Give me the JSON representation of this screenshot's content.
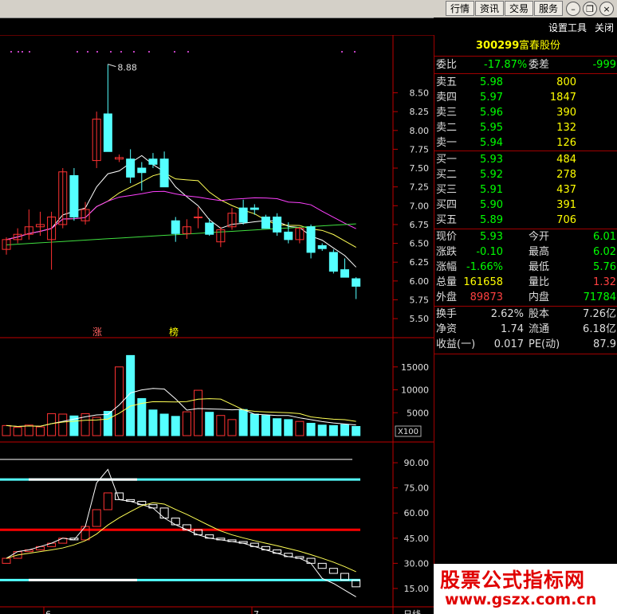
{
  "toolbar": {
    "tabs": [
      "行情",
      "资讯",
      "交易",
      "服务"
    ],
    "settings_label": "设置工具",
    "close_label": "关闭"
  },
  "stock": {
    "code": "300299",
    "name": "富春股份"
  },
  "quote_ratio": {
    "label": "委比",
    "value": "-17.87%",
    "diff_label": "委差",
    "diff_value": "-999"
  },
  "asks": [
    {
      "label": "卖五",
      "price": "5.98",
      "volume": "800"
    },
    {
      "label": "卖四",
      "price": "5.97",
      "volume": "1847"
    },
    {
      "label": "卖三",
      "price": "5.96",
      "volume": "390"
    },
    {
      "label": "卖二",
      "price": "5.95",
      "volume": "132"
    },
    {
      "label": "卖一",
      "price": "5.94",
      "volume": "126"
    }
  ],
  "bids": [
    {
      "label": "买一",
      "price": "5.93",
      "volume": "484"
    },
    {
      "label": "买二",
      "price": "5.92",
      "volume": "278"
    },
    {
      "label": "买三",
      "price": "5.91",
      "volume": "437"
    },
    {
      "label": "买四",
      "price": "5.90",
      "volume": "391"
    },
    {
      "label": "买五",
      "price": "5.89",
      "volume": "706"
    }
  ],
  "stats": [
    {
      "l1": "现价",
      "v1": "5.93",
      "c1": "#00ff00",
      "l2": "今开",
      "v2": "6.01",
      "c2": "#00ff00"
    },
    {
      "l1": "涨跌",
      "v1": "-0.10",
      "c1": "#00ff00",
      "l2": "最高",
      "v2": "6.02",
      "c2": "#00ff00"
    },
    {
      "l1": "涨幅",
      "v1": "-1.66%",
      "c1": "#00ff00",
      "l2": "最低",
      "v2": "5.76",
      "c2": "#00ff00"
    },
    {
      "l1": "总量",
      "v1": "161658",
      "c1": "#ffff00",
      "l2": "量比",
      "v2": "1.32",
      "c2": "#ff4040"
    },
    {
      "l1": "外盘",
      "v1": "89873",
      "c1": "#ff4040",
      "l2": "内盘",
      "v2": "71784",
      "c2": "#00ff00"
    }
  ],
  "fundamentals": [
    {
      "l1": "换手",
      "v1": "2.62%",
      "l2": "股本",
      "v2": "7.26亿"
    },
    {
      "l1": "净资",
      "v1": "1.74",
      "l2": "流通",
      "v2": "6.18亿"
    },
    {
      "l1": "收益(一)",
      "v1": "0.017",
      "l2": "PE(动)",
      "v2": "87.9"
    }
  ],
  "price_axis": [
    "8.50",
    "8.25",
    "8.00",
    "7.75",
    "7.50",
    "7.25",
    "7.00",
    "6.75",
    "6.50",
    "6.25",
    "6.00",
    "5.75",
    "5.50"
  ],
  "volume_axis": [
    "15000",
    "10000",
    "5000"
  ],
  "volume_unit": "X100",
  "indicator_axis": [
    "90.00",
    "75.00",
    "60.00",
    "45.00",
    "30.00",
    "15.00"
  ],
  "high_annotation": "8.88",
  "chart_markers": [
    "涨",
    "榜"
  ],
  "time_labels": [
    "6",
    "7"
  ],
  "period_label": "日线",
  "watermark": {
    "line1": "股票公式指标网",
    "line2": "www.gszx.com.cn"
  },
  "colors": {
    "up": "#ff3232",
    "down": "#54ffff",
    "panel_border": "#a00000",
    "text_up": "#ff4040",
    "text_down": "#00ff00"
  },
  "chart_data": {
    "type": "candlestick",
    "candles": [
      {
        "o": 6.42,
        "h": 6.58,
        "l": 6.35,
        "c": 6.55
      },
      {
        "o": 6.55,
        "h": 6.7,
        "l": 6.5,
        "c": 6.62
      },
      {
        "o": 6.62,
        "h": 6.95,
        "l": 6.55,
        "c": 6.72
      },
      {
        "o": 6.72,
        "h": 6.92,
        "l": 6.6,
        "c": 6.75
      },
      {
        "o": 6.55,
        "h": 6.92,
        "l": 6.15,
        "c": 6.85
      },
      {
        "o": 6.75,
        "h": 7.5,
        "l": 6.7,
        "c": 7.45
      },
      {
        "o": 7.4,
        "h": 7.5,
        "l": 6.8,
        "c": 6.85
      },
      {
        "o": 6.8,
        "h": 7.05,
        "l": 6.75,
        "c": 6.95
      },
      {
        "o": 7.6,
        "h": 8.25,
        "l": 7.5,
        "c": 8.15
      },
      {
        "o": 8.22,
        "h": 8.88,
        "l": 7.8,
        "c": 7.72
      },
      {
        "o": 7.62,
        "h": 7.68,
        "l": 7.58,
        "c": 7.64
      },
      {
        "o": 7.62,
        "h": 7.75,
        "l": 7.3,
        "c": 7.38
      },
      {
        "o": 7.5,
        "h": 7.58,
        "l": 7.2,
        "c": 7.44
      },
      {
        "o": 7.62,
        "h": 7.7,
        "l": 7.5,
        "c": 7.55
      },
      {
        "o": 7.62,
        "h": 7.72,
        "l": 7.25,
        "c": 7.25
      },
      {
        "o": 6.8,
        "h": 6.85,
        "l": 6.52,
        "c": 6.63
      },
      {
        "o": 6.63,
        "h": 6.82,
        "l": 6.56,
        "c": 6.72
      },
      {
        "o": 6.85,
        "h": 6.98,
        "l": 6.7,
        "c": 6.85
      },
      {
        "o": 6.77,
        "h": 6.83,
        "l": 6.6,
        "c": 6.62
      },
      {
        "o": 6.52,
        "h": 6.72,
        "l": 6.45,
        "c": 6.68
      },
      {
        "o": 6.72,
        "h": 6.97,
        "l": 6.68,
        "c": 6.9
      },
      {
        "o": 6.97,
        "h": 7.08,
        "l": 6.75,
        "c": 6.78
      },
      {
        "o": 6.97,
        "h": 7.02,
        "l": 6.88,
        "c": 6.95
      },
      {
        "o": 6.85,
        "h": 6.88,
        "l": 6.7,
        "c": 6.7
      },
      {
        "o": 6.85,
        "h": 6.9,
        "l": 6.6,
        "c": 6.65
      },
      {
        "o": 6.65,
        "h": 6.78,
        "l": 6.5,
        "c": 6.55
      },
      {
        "o": 6.55,
        "h": 6.72,
        "l": 6.5,
        "c": 6.7
      },
      {
        "o": 6.72,
        "h": 6.75,
        "l": 6.3,
        "c": 6.38
      },
      {
        "o": 6.47,
        "h": 6.5,
        "l": 6.4,
        "c": 6.43
      },
      {
        "o": 6.38,
        "h": 6.42,
        "l": 6.1,
        "c": 6.13
      },
      {
        "o": 6.15,
        "h": 6.3,
        "l": 6.05,
        "c": 6.05
      },
      {
        "o": 6.03,
        "h": 6.05,
        "l": 5.76,
        "c": 5.93
      }
    ],
    "volumes": [
      2200,
      1800,
      2300,
      1900,
      4800,
      4700,
      4300,
      4800,
      4000,
      5300,
      15000,
      17500,
      8100,
      5600,
      4700,
      4200,
      5200,
      9900,
      5100,
      4400,
      3500,
      5700,
      4700,
      4400,
      3700,
      3500,
      3100,
      2700,
      2300,
      2200,
      2400,
      2000
    ],
    "indicator": [
      33,
      37,
      38,
      40,
      42,
      45,
      44,
      52,
      62,
      72,
      68,
      67,
      65,
      63,
      57,
      53,
      50,
      47,
      45,
      44,
      43,
      42,
      40,
      38,
      36,
      34,
      33,
      30,
      27,
      24,
      20,
      16
    ],
    "price_ylim": [
      5.3,
      8.95
    ],
    "volume_ylim": [
      0,
      20000
    ],
    "indicator_ylim": [
      5,
      100
    ],
    "indicator_levels": [
      80,
      50,
      20
    ]
  }
}
